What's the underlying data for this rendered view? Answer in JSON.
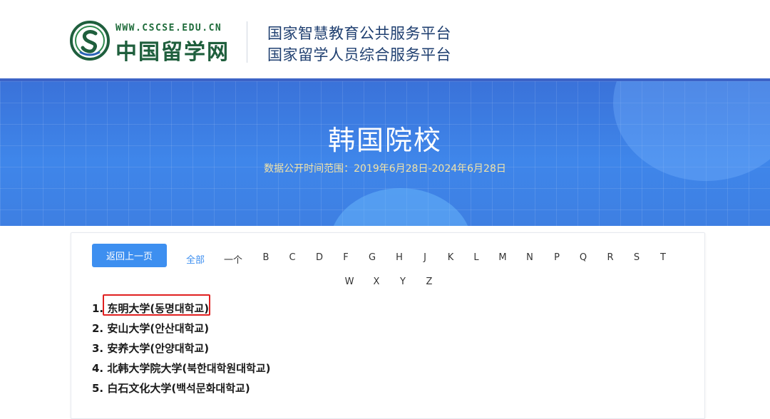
{
  "header": {
    "logo_url_text": "WWW.CSCSE.EDU.CN",
    "logo_cn_text": "中国留学网",
    "platform_line1": "国家智慧教育公共服务平台",
    "platform_line2": "国家留学人员综合服务平台"
  },
  "banner": {
    "title": "韩国院校",
    "subtitle": "数据公开时间范围：2019年6月28日-2024年6月28日"
  },
  "nav": {
    "back_label": "返回上一页",
    "all_label": "全部",
    "letters_row1": [
      "一个",
      "B",
      "C",
      "D",
      "F",
      "G",
      "H",
      "J",
      "K",
      "L",
      "M",
      "N",
      "P",
      "Q",
      "R",
      "S",
      "T"
    ],
    "letters_row2": [
      "W",
      "X",
      "Y",
      "Z"
    ]
  },
  "universities": [
    {
      "num": "1.",
      "name": "东明大学(동명대학교)"
    },
    {
      "num": "2.",
      "name": "安山大学(안산대학교)"
    },
    {
      "num": "3.",
      "name": "安养大学(안양대학교)"
    },
    {
      "num": "4.",
      "name": "北韩大学院大学(북한대학원대학교)"
    },
    {
      "num": "5.",
      "name": "白石文化大学(백석문화대학교)"
    }
  ],
  "colors": {
    "accent": "#3d8ff0",
    "highlight_border": "#e02020",
    "banner_blue": "#3f86ea",
    "subtitle_gold": "#f1e3a8"
  }
}
